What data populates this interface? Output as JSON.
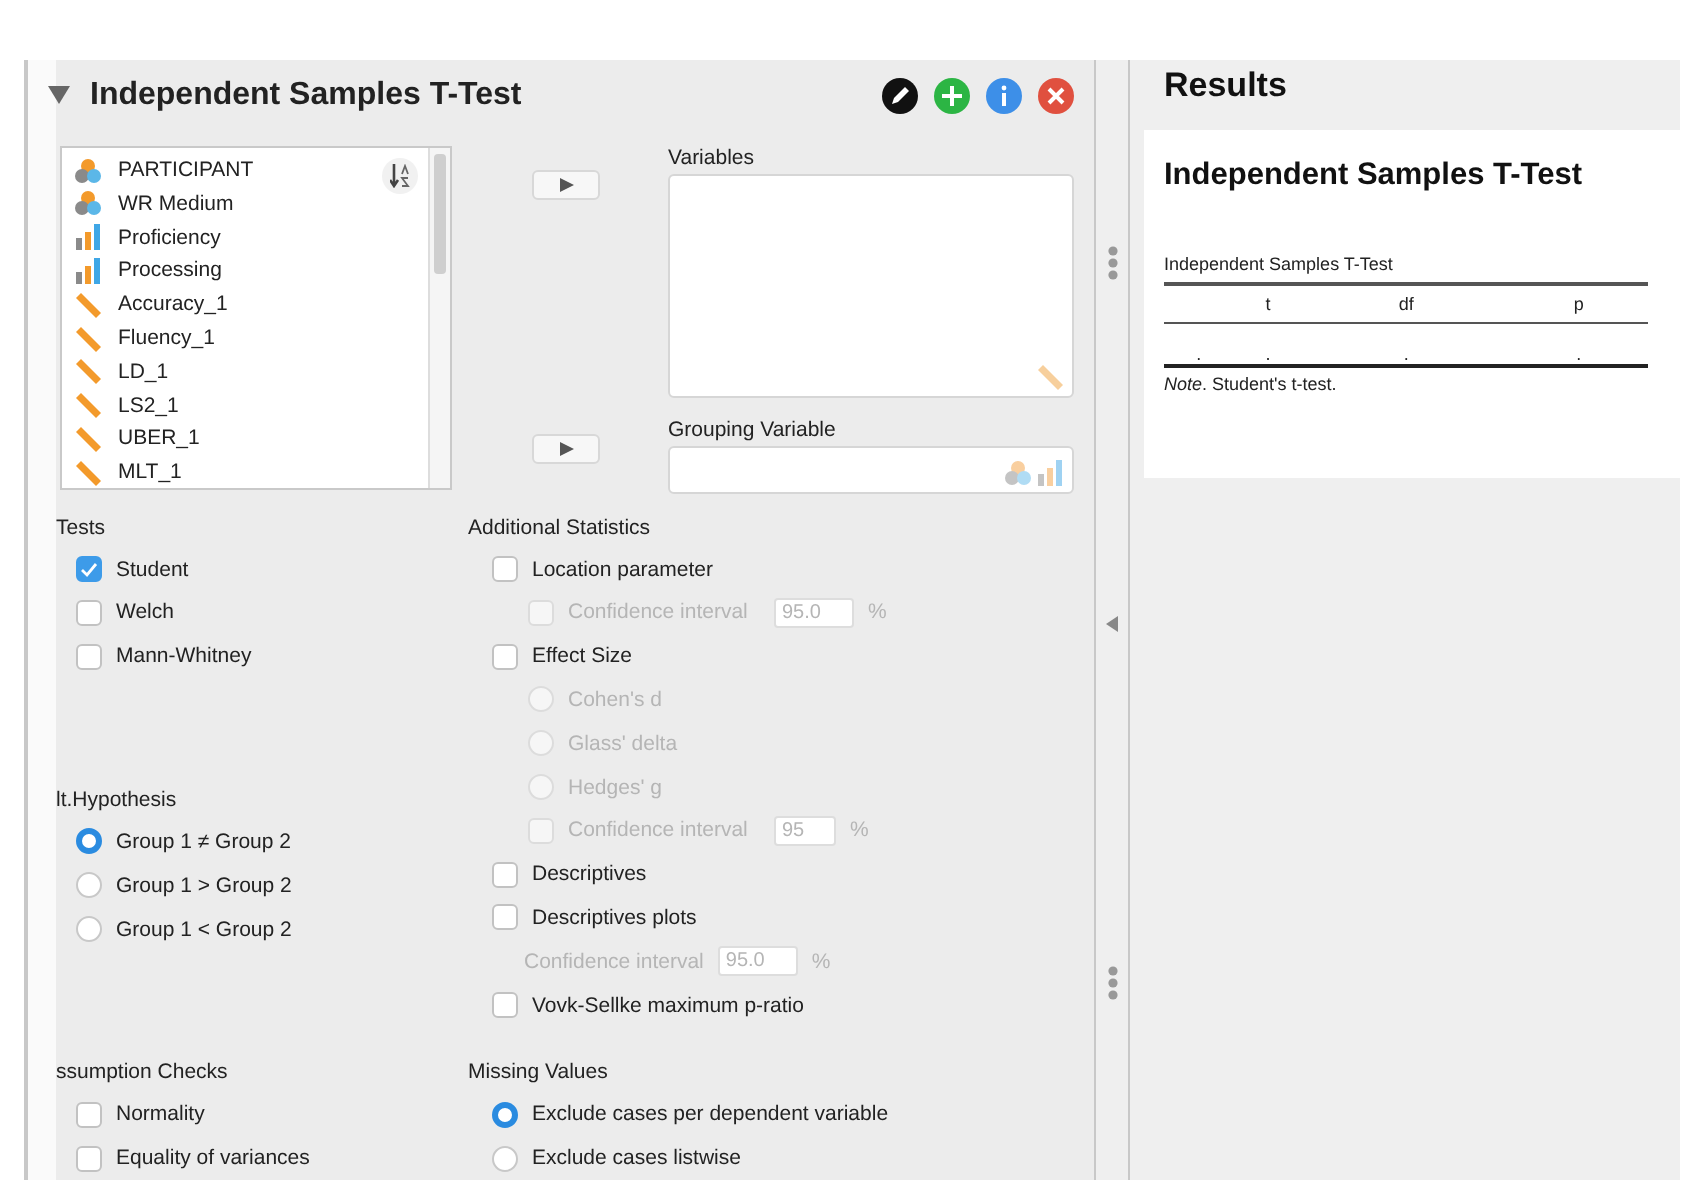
{
  "analysis": {
    "title": "Independent Samples T-Test",
    "expanded": true
  },
  "variable_list": {
    "items": [
      {
        "name": "PARTICIPANT",
        "kind": "nominal"
      },
      {
        "name": "WR Medium",
        "kind": "nominal"
      },
      {
        "name": "Proficiency",
        "kind": "ordinal"
      },
      {
        "name": "Processing",
        "kind": "ordinal"
      },
      {
        "name": "Accuracy_1",
        "kind": "scale"
      },
      {
        "name": "Fluency_1",
        "kind": "scale"
      },
      {
        "name": "LD_1",
        "kind": "scale"
      },
      {
        "name": "LS2_1",
        "kind": "scale"
      },
      {
        "name": "UBER_1",
        "kind": "scale"
      },
      {
        "name": "MLT_1",
        "kind": "scale"
      }
    ]
  },
  "variables_box": {
    "label": "Variables"
  },
  "grouping_box": {
    "label": "Grouping Variable"
  },
  "tests": {
    "label": "Tests",
    "options": [
      {
        "label": "Student",
        "checked": true
      },
      {
        "label": "Welch",
        "checked": false
      },
      {
        "label": "Mann-Whitney",
        "checked": false
      }
    ]
  },
  "alt_hypothesis": {
    "label": "lt.Hypothesis",
    "options": [
      {
        "label": "Group 1 ≠ Group 2",
        "selected": true
      },
      {
        "label": "Group 1 > Group 2",
        "selected": false
      },
      {
        "label": "Group 1 < Group 2",
        "selected": false
      }
    ]
  },
  "additional_statistics": {
    "label": "Additional Statistics",
    "items": [
      {
        "kind": "checkbox",
        "label": "Location parameter",
        "checked": false,
        "disabled": false,
        "children": [
          {
            "kind": "checkbox_field",
            "label": "Confidence interval",
            "checked": false,
            "disabled": true,
            "value": "95.0",
            "unit": "%"
          }
        ]
      },
      {
        "kind": "checkbox",
        "label": "Effect Size",
        "checked": false,
        "disabled": false,
        "children": [
          {
            "kind": "radio",
            "label": "Cohen's d",
            "selected": false,
            "disabled": true
          },
          {
            "kind": "radio",
            "label": "Glass' delta",
            "selected": false,
            "disabled": true
          },
          {
            "kind": "radio",
            "label": "Hedges' g",
            "selected": false,
            "disabled": true
          },
          {
            "kind": "checkbox_field",
            "label": "Confidence interval",
            "checked": false,
            "disabled": true,
            "value": "95",
            "unit": "%"
          }
        ]
      },
      {
        "kind": "checkbox",
        "label": "Descriptives",
        "checked": false,
        "disabled": false
      },
      {
        "kind": "checkbox",
        "label": "Descriptives plots",
        "checked": false,
        "disabled": false,
        "children": [
          {
            "kind": "field",
            "label": "Confidence interval",
            "disabled": true,
            "value": "95.0",
            "unit": "%"
          }
        ]
      },
      {
        "kind": "checkbox",
        "label": "Vovk-Sellke maximum p-ratio",
        "checked": false,
        "disabled": false
      }
    ]
  },
  "assumption_checks": {
    "label": "ssumption Checks",
    "options": [
      {
        "label": "Normality",
        "checked": false
      },
      {
        "label": "Equality of variances",
        "checked": false
      }
    ]
  },
  "missing_values": {
    "label": "Missing Values",
    "options": [
      {
        "label": "Exclude cases per dependent variable",
        "selected": true
      },
      {
        "label": "Exclude cases listwise",
        "selected": false
      }
    ]
  },
  "results": {
    "title": "Results",
    "analysis_title": "Independent Samples T-Test",
    "table": {
      "title": "Independent Samples T-Test",
      "columns": [
        "",
        "t",
        "df",
        "p"
      ],
      "rows": [
        [
          ".",
          ".",
          ".",
          "."
        ]
      ],
      "note": "*Note*. Student's t-test."
    }
  }
}
